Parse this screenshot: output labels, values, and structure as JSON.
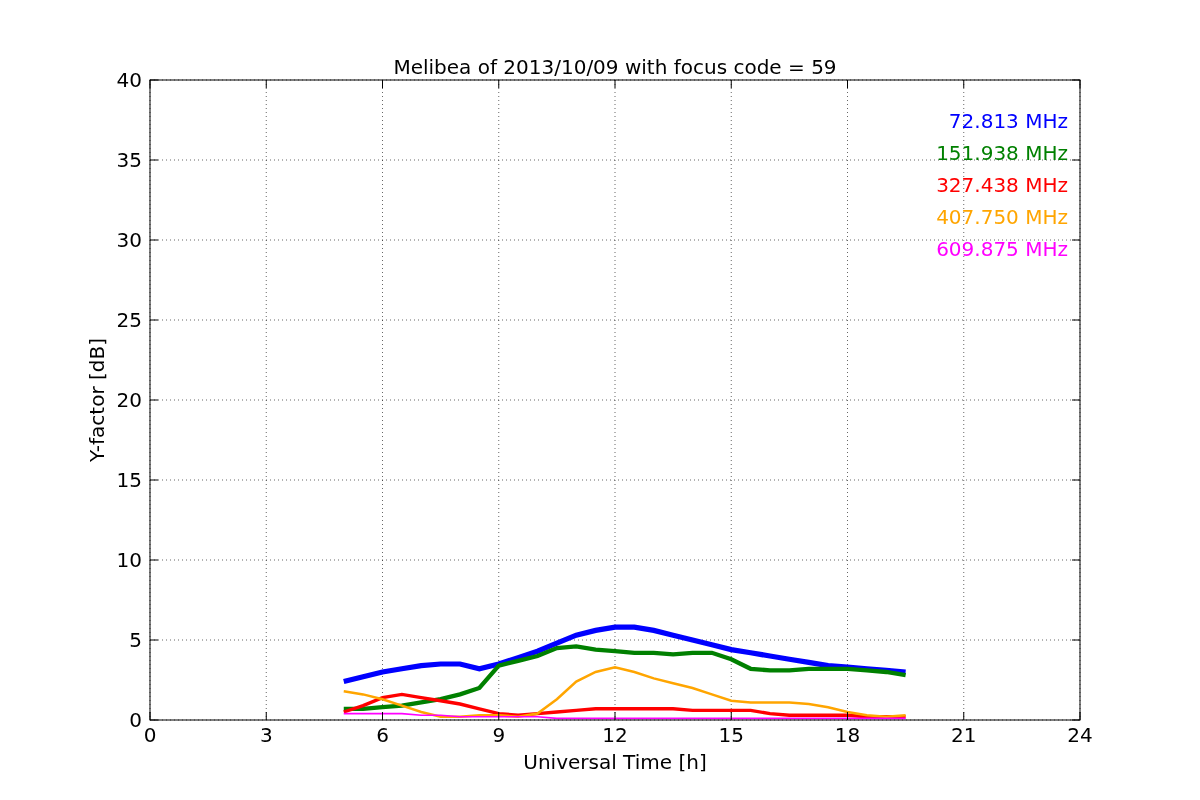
{
  "chart_data": {
    "type": "line",
    "title": "Melibea of 2013/10/09 with focus code = 59",
    "xlabel": "Universal Time [h]",
    "ylabel": "Y-factor [dB]",
    "x": [
      5,
      5.5,
      6,
      6.5,
      7,
      7.5,
      8,
      8.5,
      9,
      9.5,
      10,
      10.5,
      11,
      11.5,
      12,
      12.5,
      13,
      13.5,
      14,
      14.5,
      15,
      15.5,
      16,
      16.5,
      17,
      17.5,
      18,
      18.5,
      19,
      19.5
    ],
    "series": [
      {
        "name": "72.813 MHz",
        "color": "#0000ff",
        "values": [
          2.4,
          2.7,
          3.0,
          3.2,
          3.4,
          3.5,
          3.5,
          3.2,
          3.5,
          3.9,
          4.3,
          4.8,
          5.3,
          5.6,
          5.8,
          5.8,
          5.6,
          5.3,
          5.0,
          4.7,
          4.4,
          4.2,
          4.0,
          3.8,
          3.6,
          3.4,
          3.3,
          3.2,
          3.1,
          3.0
        ]
      },
      {
        "name": "151.938 MHz",
        "color": "#008000",
        "values": [
          0.7,
          0.7,
          0.8,
          0.9,
          1.1,
          1.3,
          1.6,
          2.0,
          3.4,
          3.7,
          4.0,
          4.5,
          4.6,
          4.4,
          4.3,
          4.2,
          4.2,
          4.1,
          4.2,
          4.2,
          3.8,
          3.2,
          3.1,
          3.1,
          3.2,
          3.2,
          3.2,
          3.1,
          3.0,
          2.8
        ]
      },
      {
        "name": "327.438 MHz",
        "color": "#ff0000",
        "values": [
          0.5,
          0.9,
          1.4,
          1.6,
          1.4,
          1.2,
          1.0,
          0.7,
          0.4,
          0.3,
          0.4,
          0.5,
          0.6,
          0.7,
          0.7,
          0.7,
          0.7,
          0.7,
          0.6,
          0.6,
          0.6,
          0.6,
          0.4,
          0.3,
          0.3,
          0.3,
          0.3,
          0.2,
          0.2,
          0.2
        ]
      },
      {
        "name": "407.750 MHz",
        "color": "#ffa500",
        "values": [
          1.8,
          1.6,
          1.3,
          0.9,
          0.5,
          0.2,
          0.2,
          0.3,
          0.3,
          0.2,
          0.4,
          1.3,
          2.4,
          3.0,
          3.3,
          3.0,
          2.6,
          2.3,
          2.0,
          1.6,
          1.2,
          1.1,
          1.1,
          1.1,
          1.0,
          0.8,
          0.5,
          0.3,
          0.2,
          0.3
        ]
      },
      {
        "name": "609.875 MHz",
        "color": "#ff00ff",
        "values": [
          0.4,
          0.4,
          0.4,
          0.4,
          0.3,
          0.3,
          0.2,
          0.2,
          0.2,
          0.2,
          0.2,
          0.1,
          0.1,
          0.1,
          0.1,
          0.1,
          0.1,
          0.1,
          0.1,
          0.1,
          0.1,
          0.1,
          0.1,
          0.1,
          0.1,
          0.1,
          0.1,
          0.1,
          0.1,
          0.1
        ]
      }
    ],
    "grid": true,
    "xlim": [
      0,
      24
    ],
    "ylim": [
      0,
      40
    ],
    "xticks": [
      0,
      3,
      6,
      9,
      12,
      15,
      18,
      21,
      24
    ],
    "yticks": [
      0,
      5,
      10,
      15,
      20,
      25,
      30,
      35,
      40
    ]
  }
}
